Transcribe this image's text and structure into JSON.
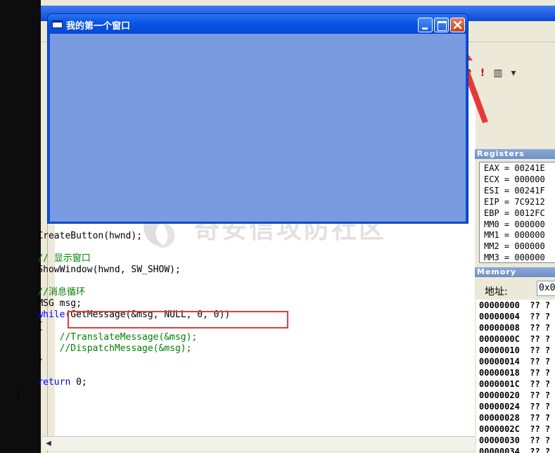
{
  "app_window": {
    "title": "我的第一个窗口",
    "client_color": "#7b9be0",
    "caption_buttons": [
      "minimize",
      "maximize",
      "close"
    ]
  },
  "code_editor": {
    "lines": [
      {
        "indent": 4,
        "parts": [
          {
            "text": "CreateButton(hwnd);",
            "type": "plain"
          }
        ]
      },
      {
        "indent": 0,
        "parts": [
          {
            "text": "",
            "type": "plain"
          }
        ]
      },
      {
        "indent": 4,
        "parts": [
          {
            "text": "// 显示窗口",
            "type": "comment"
          }
        ]
      },
      {
        "indent": 4,
        "parts": [
          {
            "text": "ShowWindow(hwnd, SW_SHOW);",
            "type": "plain"
          }
        ]
      },
      {
        "indent": 0,
        "parts": [
          {
            "text": "",
            "type": "plain"
          }
        ]
      },
      {
        "indent": 4,
        "parts": [
          {
            "text": "//消息循环",
            "type": "comment"
          }
        ]
      },
      {
        "indent": 4,
        "parts": [
          {
            "text": "MSG msg;",
            "type": "plain"
          }
        ]
      },
      {
        "indent": 4,
        "parts": [
          {
            "text": "while",
            "type": "keyword"
          },
          {
            "text": "(GetMessage(&msg, NULL, 0, 0))",
            "type": "plain"
          }
        ]
      },
      {
        "indent": 4,
        "parts": [
          {
            "text": "{",
            "type": "plain"
          }
        ]
      },
      {
        "indent": 8,
        "parts": [
          {
            "text": "//TranslateMessage(&msg);",
            "type": "comment"
          }
        ]
      },
      {
        "indent": 8,
        "parts": [
          {
            "text": "//DispatchMessage(&msg);",
            "type": "comment"
          }
        ]
      },
      {
        "indent": 4,
        "parts": [
          {
            "text": "}",
            "type": "plain"
          }
        ]
      },
      {
        "indent": 0,
        "parts": [
          {
            "text": "",
            "type": "plain"
          }
        ]
      },
      {
        "indent": 4,
        "parts": [
          {
            "text": "return",
            "type": "keyword"
          },
          {
            "text": " 0;",
            "type": "plain"
          }
        ]
      },
      {
        "indent": 0,
        "parts": [
          {
            "text": "}",
            "type": "plain"
          }
        ]
      }
    ]
  },
  "registers": {
    "title": "Registers",
    "rows": [
      "EAX = 00241E",
      "ECX = 000000",
      "ESI = 00241F",
      "EIP = 7C9212",
      "EBP = 0012FC",
      "MM0 = 000000",
      "MM1 = 000000",
      "MM2 = 000000",
      "MM3 = 000000"
    ]
  },
  "memory": {
    "title": "Memory",
    "address_label": "地址:",
    "address_value": "0x0",
    "rows": [
      "00000000  ?? ?",
      "00000004  ?? ?",
      "00000008  ?? ?",
      "0000000C  ?? ?",
      "00000010  ?? ?",
      "00000014  ?? ?",
      "00000018  ?? ?",
      "0000001C  ?? ?",
      "00000020  ?? ?",
      "00000024  ?? ?",
      "00000028  ?? ?",
      "0000002C  ?? ?",
      "00000030  ?? ?",
      "00000034  ?? ?"
    ]
  },
  "watermark": {
    "text": "奇安信攻防社区"
  },
  "colors": {
    "keyword": "#0000ff",
    "comment": "#008000",
    "annotation": "#e8393a"
  }
}
